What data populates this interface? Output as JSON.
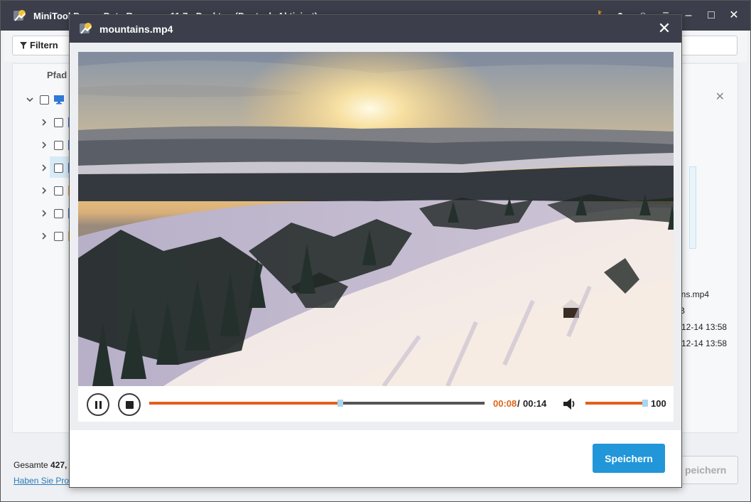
{
  "app": {
    "title": "MiniTool Power Data Recovery 11.7 - Desktop (Deutsch-Aktiviert)",
    "filter_label": "Filtern",
    "path_header": "Pfad",
    "details": {
      "file_name": "tains.mp4",
      "size": "MB",
      "created": "12-14 13:58",
      "modified": "12-14 13:58"
    },
    "total_label": "Gesamte",
    "total_value": "427,",
    "help_link": "Haben Sie Pro",
    "save_label": "peichern"
  },
  "modal": {
    "title": "mountains.mp4",
    "close_symbol": "✕"
  },
  "player": {
    "current_time": "00:08",
    "separator": " /",
    "total_time": "00:14",
    "progress_fraction": 0.57,
    "volume_value": "100",
    "volume_fraction": 1.0
  },
  "actions": {
    "save_label": "Speichern"
  },
  "colors": {
    "titlebar": "#3c3f4b",
    "accent_orange": "#e2601b",
    "save_blue": "#2196d8"
  }
}
